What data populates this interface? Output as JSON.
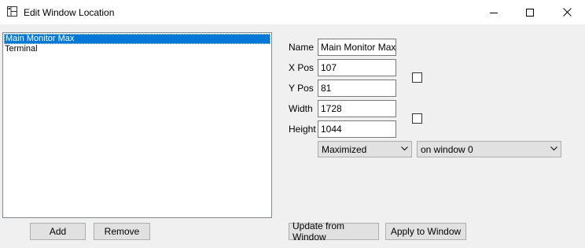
{
  "window": {
    "title": "Edit Window Location",
    "controls": {
      "minimize_icon": "minimize-icon",
      "maximize_icon": "maximize-icon",
      "close_icon": "close-icon"
    }
  },
  "list": {
    "items": [
      {
        "label": "Main Monitor Max",
        "selected": true
      },
      {
        "label": "Terminal",
        "selected": false
      }
    ]
  },
  "buttons": {
    "add": "Add",
    "remove": "Remove",
    "update_from_window": "Update from Window",
    "apply_to_window": "Apply to Window"
  },
  "form": {
    "name_label": "Name",
    "name_value": "Main Monitor Max",
    "xpos_label": "X Pos",
    "xpos_value": "107",
    "ypos_label": "Y Pos",
    "ypos_value": "81",
    "width_label": "Width",
    "width_value": "1728",
    "height_label": "Height",
    "height_value": "1044",
    "position_checkbox_checked": false,
    "size_checkbox_checked": false,
    "state_selected": "Maximized",
    "monitor_selected": "on window 0"
  },
  "colors": {
    "selection": "#0078d7",
    "window_bg": "#f0f0f0",
    "titlebar_bg": "#ffffff"
  }
}
